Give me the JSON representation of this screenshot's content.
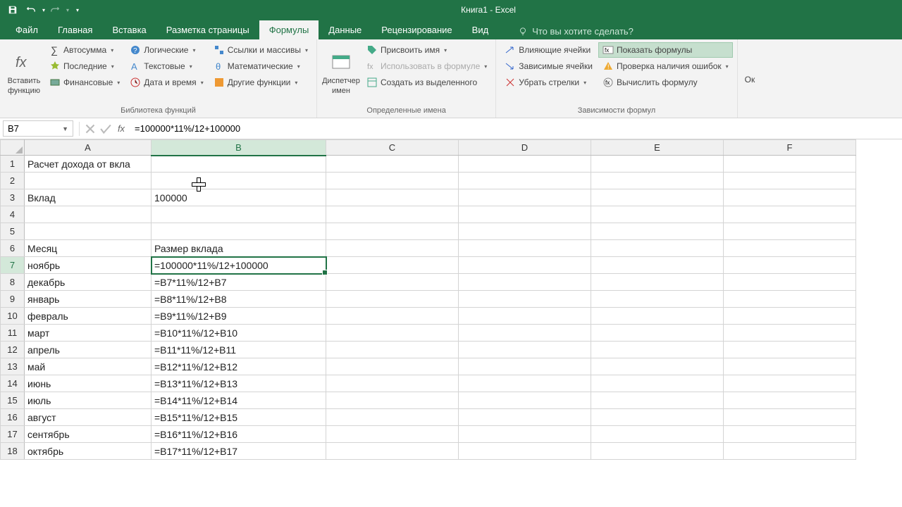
{
  "app": {
    "title": "Книга1 - Excel"
  },
  "qat": {
    "save": "save",
    "undo": "undo",
    "redo": "redo"
  },
  "tabs": {
    "file": "Файл",
    "home": "Главная",
    "insert": "Вставка",
    "layout": "Разметка страницы",
    "formulas": "Формулы",
    "data": "Данные",
    "review": "Рецензирование",
    "view": "Вид",
    "tellme": "Что вы хотите сделать?"
  },
  "ribbon": {
    "insert_fn": "Вставить функцию",
    "lib": {
      "autosum": "Автосумма",
      "recent": "Последние",
      "financial": "Финансовые",
      "logical": "Логические",
      "text": "Текстовые",
      "datetime": "Дата и время",
      "lookup": "Ссылки и массивы",
      "math": "Математические",
      "more": "Другие функции",
      "group": "Библиотека функций"
    },
    "names": {
      "manager": "Диспетчер имен",
      "define": "Присвоить имя",
      "use": "Использовать в формуле",
      "create": "Создать из выделенного",
      "group": "Определенные имена"
    },
    "audit": {
      "trace_prec": "Влияющие ячейки",
      "trace_dep": "Зависимые ячейки",
      "remove": "Убрать стрелки",
      "show_formulas": "Показать формулы",
      "error_check": "Проверка наличия ошибок",
      "evaluate": "Вычислить формулу",
      "group": "Зависимости формул"
    },
    "options": "Ок"
  },
  "fbar": {
    "name": "B7",
    "formula": "=100000*11%/12+100000"
  },
  "columns": [
    "A",
    "B",
    "C",
    "D",
    "E",
    "F"
  ],
  "rows": [
    {
      "n": "1",
      "a": "Расчет дохода от вкла",
      "b": ""
    },
    {
      "n": "2",
      "a": "",
      "b": ""
    },
    {
      "n": "3",
      "a": "Вклад",
      "b": "100000"
    },
    {
      "n": "4",
      "a": "",
      "b": ""
    },
    {
      "n": "5",
      "a": "",
      "b": ""
    },
    {
      "n": "6",
      "a": "Месяц",
      "b": "Размер вклада"
    },
    {
      "n": "7",
      "a": "ноябрь",
      "b": "=100000*11%/12+100000"
    },
    {
      "n": "8",
      "a": "декабрь",
      "b": "=B7*11%/12+B7"
    },
    {
      "n": "9",
      "a": "январь",
      "b": "=B8*11%/12+B8"
    },
    {
      "n": "10",
      "a": "февраль",
      "b": "=B9*11%/12+B9"
    },
    {
      "n": "11",
      "a": "март",
      "b": "=B10*11%/12+B10"
    },
    {
      "n": "12",
      "a": "апрель",
      "b": "=B11*11%/12+B11"
    },
    {
      "n": "13",
      "a": "май",
      "b": "=B12*11%/12+B12"
    },
    {
      "n": "14",
      "a": "июнь",
      "b": "=B13*11%/12+B13"
    },
    {
      "n": "15",
      "a": "июль",
      "b": "=B14*11%/12+B14"
    },
    {
      "n": "16",
      "a": "август",
      "b": "=B15*11%/12+B15"
    },
    {
      "n": "17",
      "a": "сентябрь",
      "b": "=B16*11%/12+B16"
    },
    {
      "n": "18",
      "a": "октябрь",
      "b": "=B17*11%/12+B17"
    }
  ],
  "active": {
    "row": "7",
    "col": "B"
  }
}
